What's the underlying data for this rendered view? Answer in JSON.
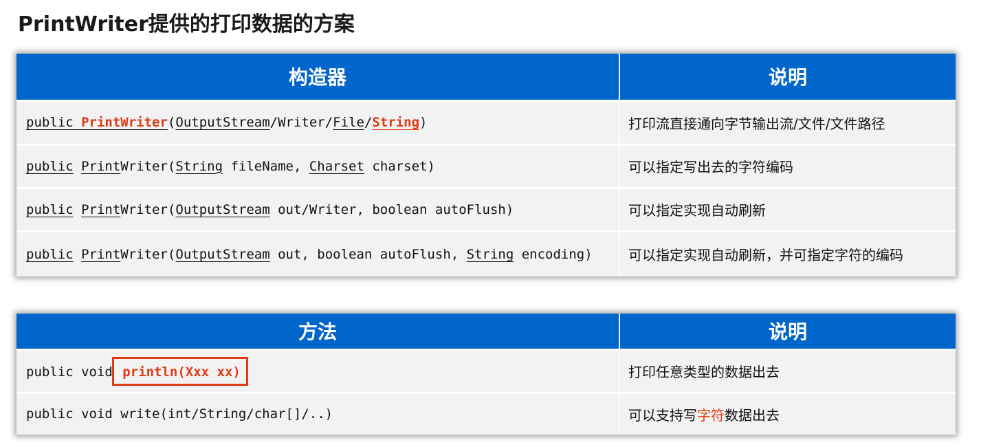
{
  "title": "PrintWriter提供的打印数据的方案",
  "constructors": {
    "header_col1": "构造器",
    "header_col2": "说明",
    "rows": [
      {
        "sig_p1": "public ",
        "sig_p2": "Print",
        "sig_p3": "Writer",
        "sig_p4": "(",
        "sig_p5": "OutputStream",
        "sig_p6": "/Writer/",
        "sig_p7": "File",
        "sig_p8": "/",
        "sig_p9": "String",
        "sig_p10": ")",
        "desc": "打印流直接通向字节输出流/文件/文件路径"
      },
      {
        "sig_p1": "public",
        "sig_p2": " ",
        "sig_p3": "Print",
        "sig_p4": "Writer(",
        "sig_p5": "String",
        "sig_p6": " fileName, ",
        "sig_p7": "Charset",
        "sig_p8": " charset)",
        "desc": "可以指定写出去的字符编码"
      },
      {
        "sig_p1": "public",
        "sig_p2": " ",
        "sig_p3": "Print",
        "sig_p4": "Writer(",
        "sig_p5": "OutputStream",
        "sig_p6": " out/Writer, boolean autoFlush)",
        "desc": "可以指定实现自动刷新"
      },
      {
        "sig_p1": "public",
        "sig_p2": " ",
        "sig_p3": "Print",
        "sig_p4": "Writer(",
        "sig_p5": "OutputStream",
        "sig_p6": " out, boolean autoFlush, ",
        "sig_p7": "String",
        "sig_p8": " encoding)",
        "desc": "可以指定实现自动刷新，并可指定字符的编码"
      }
    ]
  },
  "methods": {
    "header_col1": "方法",
    "header_col2": "说明",
    "rows": [
      {
        "sig_prefix": "public void ",
        "sig_highlight": "println(Xxx xx)",
        "desc": "打印任意类型的数据出去"
      },
      {
        "sig": "public void write(int/String/char[]/..)",
        "desc_p1": "可以支持写",
        "desc_highlight": "字符",
        "desc_p2": "数据出去"
      }
    ]
  },
  "colors": {
    "header_bg": "#0066cc",
    "row_bg": "#f2f2f2",
    "highlight": "#e03a14"
  }
}
